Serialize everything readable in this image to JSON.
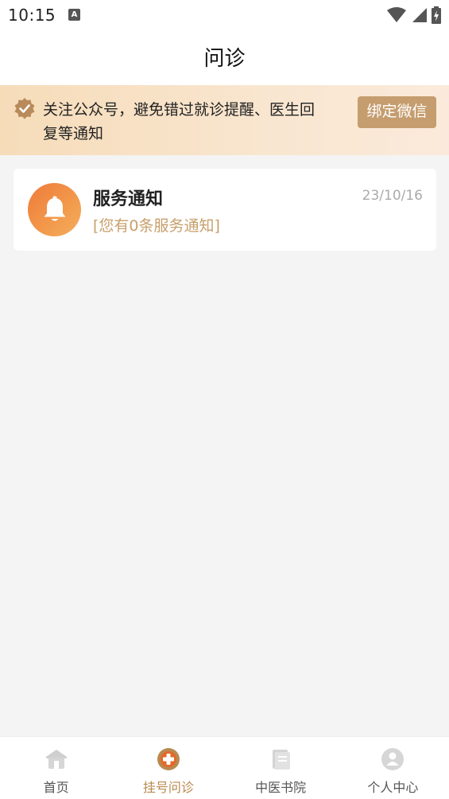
{
  "status_bar": {
    "time": "10:15",
    "notification_icon": "A",
    "icons": [
      "wifi-icon",
      "signal-icon",
      "battery-charging-icon"
    ]
  },
  "header": {
    "title": "问诊"
  },
  "notice": {
    "icon": "verified-badge-icon",
    "text": "关注公众号，避免错过就诊提醒、医生回复等通知",
    "button_label": "绑定微信"
  },
  "messages": [
    {
      "icon": "bell-icon",
      "title": "服务通知",
      "date": "23/10/16",
      "subtitle": "[您有0条服务通知]"
    }
  ],
  "tab_bar": {
    "items": [
      {
        "label": "首页",
        "icon": "home-icon",
        "active": false
      },
      {
        "label": "挂号问诊",
        "icon": "medical-cross-icon",
        "active": true
      },
      {
        "label": "中医书院",
        "icon": "book-icon",
        "active": false
      },
      {
        "label": "个人中心",
        "icon": "user-icon",
        "active": false
      }
    ]
  },
  "colors": {
    "accent": "#c59d6e",
    "active_tab": "#b98a4f",
    "subtitle": "#c89f6b",
    "bell_gradient_start": "#ef7a3a",
    "bell_gradient_end": "#f4ad5e",
    "banner_bg": "#f6dcb9"
  }
}
